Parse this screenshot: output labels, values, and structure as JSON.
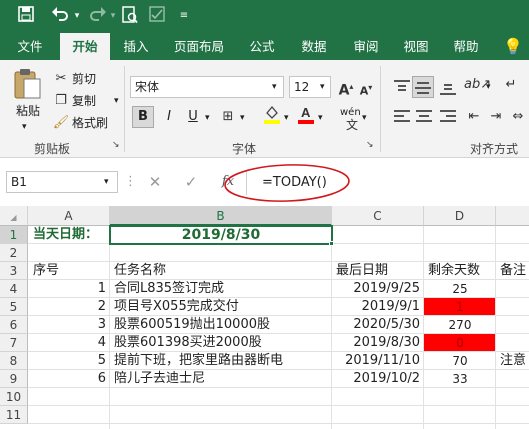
{
  "qat": {
    "save_icon": "save-icon",
    "undo_icon": "undo-icon",
    "redo_icon": "redo-icon",
    "preview_icon": "print-preview-icon",
    "format_icon": "format-icon",
    "more_icon": "customize-qat-icon"
  },
  "tabs": [
    {
      "label": "文件"
    },
    {
      "label": "开始"
    },
    {
      "label": "插入"
    },
    {
      "label": "页面布局"
    },
    {
      "label": "公式"
    },
    {
      "label": "数据"
    },
    {
      "label": "审阅"
    },
    {
      "label": "视图"
    },
    {
      "label": "帮助"
    }
  ],
  "ribbon": {
    "clipboard": {
      "paste": "粘贴",
      "cut": "剪切",
      "copy": "复制",
      "format_painter": "格式刷",
      "group": "剪贴板"
    },
    "font": {
      "name": "宋体",
      "size": "12",
      "bold": "B",
      "italic": "I",
      "underline": "U",
      "phonetic": "wén",
      "group": "字体",
      "fill_color": "#ffff00",
      "font_color": "#ff0000"
    },
    "alignment": {
      "group": "对齐方式"
    }
  },
  "formula_bar": {
    "name_box": "B1",
    "fx": "fx",
    "formula": "=TODAY()",
    "annotation_color": "#d0181d"
  },
  "columns": [
    "A",
    "B",
    "C",
    "D"
  ],
  "rows": [
    "1",
    "2",
    "3",
    "4",
    "5",
    "6",
    "7",
    "8",
    "9",
    "10",
    "11"
  ],
  "sheet": {
    "r1": {
      "a": "当天日期：",
      "b": "2019/8/30"
    },
    "headers": {
      "a": "序号",
      "b": "任务名称",
      "c": "最后日期",
      "d": "剩余天数",
      "e": "备注"
    },
    "tasks": [
      {
        "num": "1",
        "name": "合同L835签订完成",
        "date": "2019/9/25",
        "days": "25",
        "alert": false
      },
      {
        "num": "2",
        "name": "项目号X055完成交付",
        "date": "2019/9/1",
        "days": "1",
        "alert": true
      },
      {
        "num": "3",
        "name": "股票600519抛出10000股",
        "date": "2020/5/30",
        "days": "270",
        "alert": false
      },
      {
        "num": "4",
        "name": "股票601398买进2000股",
        "date": "2019/8/30",
        "days": "0",
        "alert": true
      },
      {
        "num": "5",
        "name": "提前下班，把家里路由器断电",
        "date": "2019/11/10",
        "days": "70",
        "note": "注意",
        "alert": false
      },
      {
        "num": "6",
        "name": "陪儿子去迪士尼",
        "date": "2019/10/2",
        "days": "33",
        "alert": false
      }
    ],
    "green": "#1f6b33",
    "alert_red": "#ff0000"
  }
}
